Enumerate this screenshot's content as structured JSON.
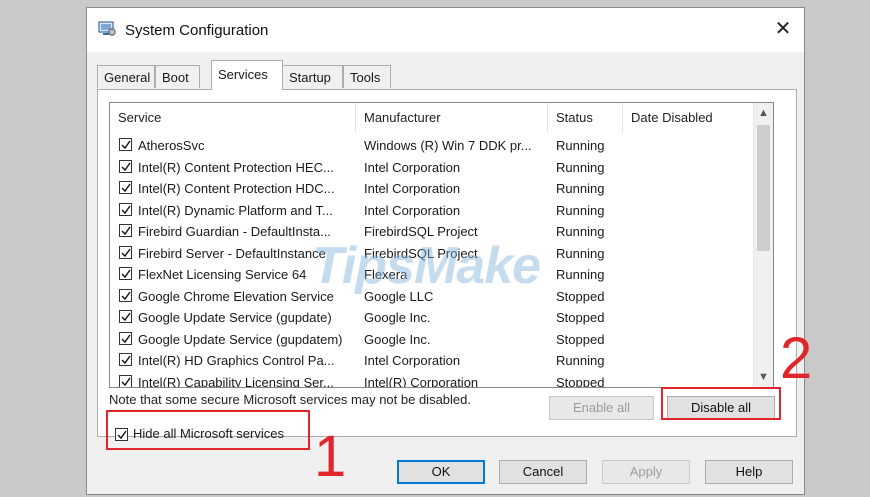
{
  "window": {
    "title": "System Configuration",
    "close_label": "✕"
  },
  "tabs": [
    {
      "label": "General"
    },
    {
      "label": "Boot"
    },
    {
      "label": "Services",
      "active": true
    },
    {
      "label": "Startup"
    },
    {
      "label": "Tools"
    }
  ],
  "list": {
    "columns": [
      "Service",
      "Manufacturer",
      "Status",
      "Date Disabled"
    ],
    "rows": [
      {
        "service": "AtherosSvc",
        "manufacturer": "Windows (R) Win 7 DDK pr...",
        "status": "Running",
        "checked": true
      },
      {
        "service": "Intel(R) Content Protection HEC...",
        "manufacturer": "Intel Corporation",
        "status": "Running",
        "checked": true
      },
      {
        "service": "Intel(R) Content Protection HDC...",
        "manufacturer": "Intel Corporation",
        "status": "Running",
        "checked": true
      },
      {
        "service": "Intel(R) Dynamic Platform and T...",
        "manufacturer": "Intel Corporation",
        "status": "Running",
        "checked": true
      },
      {
        "service": "Firebird Guardian - DefaultInsta...",
        "manufacturer": "FirebirdSQL Project",
        "status": "Running",
        "checked": true
      },
      {
        "service": "Firebird Server - DefaultInstance",
        "manufacturer": "FirebirdSQL Project",
        "status": "Running",
        "checked": true
      },
      {
        "service": "FlexNet Licensing Service 64",
        "manufacturer": "Flexera",
        "status": "Running",
        "checked": true
      },
      {
        "service": "Google Chrome Elevation Service",
        "manufacturer": "Google LLC",
        "status": "Stopped",
        "checked": true
      },
      {
        "service": "Google Update Service (gupdate)",
        "manufacturer": "Google Inc.",
        "status": "Stopped",
        "checked": true
      },
      {
        "service": "Google Update Service (gupdatem)",
        "manufacturer": "Google Inc.",
        "status": "Stopped",
        "checked": true
      },
      {
        "service": "Intel(R) HD Graphics Control Pa...",
        "manufacturer": "Intel Corporation",
        "status": "Running",
        "checked": true
      },
      {
        "service": "Intel(R) Capability Licensing Ser...",
        "manufacturer": "Intel(R) Corporation",
        "status": "Stopped",
        "checked": true
      }
    ]
  },
  "note": "Note that some secure Microsoft services may not be disabled.",
  "buttons": {
    "enable_all": "Enable all",
    "disable_all": "Disable all",
    "ok": "OK",
    "cancel": "Cancel",
    "apply": "Apply",
    "help": "Help"
  },
  "hide_ms": {
    "label": "Hide all Microsoft services",
    "checked": true
  },
  "annotations": {
    "one": "1",
    "two": "2"
  },
  "watermark": "TipsMake",
  "colors": {
    "annotation": "#e0262a",
    "accent": "#0078d7"
  }
}
